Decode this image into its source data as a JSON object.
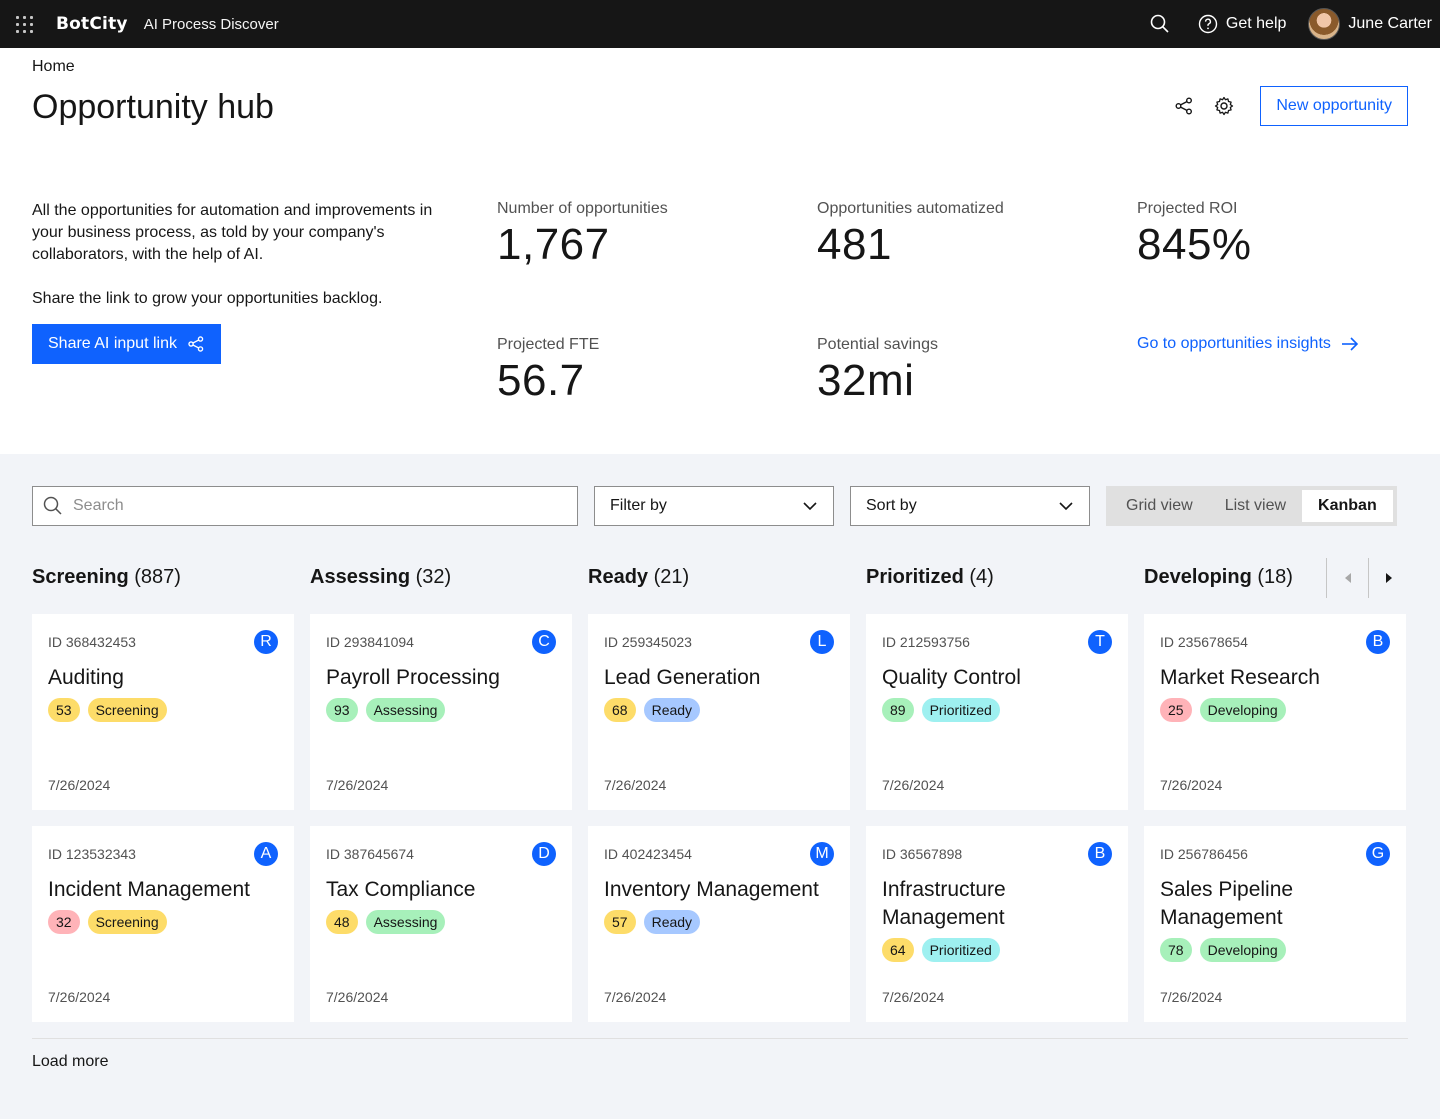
{
  "topbar": {
    "brand": "BotCity",
    "app_name": "AI Process Discover",
    "help_label": "Get help",
    "user_name": "June Carter"
  },
  "header": {
    "breadcrumb": "Home",
    "title": "Opportunity hub",
    "new_button": "New opportunity",
    "intro_line1": "All the opportunities for automation and improvements in your business process, as told by your company's collaborators, with the help of AI.",
    "intro_line2": "Share the link to grow your opportunities backlog.",
    "share_button": "Share AI input link",
    "insights_link": "Go to opportunities insights"
  },
  "metrics": [
    {
      "label": "Number of opportunities",
      "value": "1,767"
    },
    {
      "label": "Opportunities automatized",
      "value": "481"
    },
    {
      "label": "Projected ROI",
      "value": "845%"
    },
    {
      "label": "Projected FTE",
      "value": "56.7"
    },
    {
      "label": "Potential savings",
      "value": "32mi"
    }
  ],
  "toolbar": {
    "search_placeholder": "Search",
    "filter_label": "Filter by",
    "sort_label": "Sort by",
    "views": [
      "Grid view",
      "List view",
      "Kanban"
    ],
    "active_view": "Kanban"
  },
  "columns": [
    {
      "name": "Screening",
      "count": "(887)"
    },
    {
      "name": "Assessing",
      "count": "(32)"
    },
    {
      "name": "Ready",
      "count": "(21)"
    },
    {
      "name": "Prioritized",
      "count": "(4)"
    },
    {
      "name": "Developing",
      "count": "(18)"
    }
  ],
  "colors": {
    "accent": "#0f62fe",
    "status_screening": "#fddc69",
    "status_assessing": "#a7f0ba",
    "status_ready": "#a6c8ff",
    "status_prioritized": "#9ef0f0",
    "status_developing": "#a7f0ba",
    "score_yellow": "#fddc69",
    "score_green": "#a7f0ba",
    "score_red": "#ffb3b8"
  },
  "cards": [
    [
      {
        "id": "ID 368432453",
        "initial": "R",
        "title": "Auditing",
        "score": "53",
        "score_color": "#fddc69",
        "status": "Screening",
        "status_color": "#fddc69",
        "date": "7/26/2024"
      },
      {
        "id": "ID 123532343",
        "initial": "A",
        "title": "Incident Management",
        "score": "32",
        "score_color": "#ffb3b8",
        "status": "Screening",
        "status_color": "#fddc69",
        "date": "7/26/2024"
      }
    ],
    [
      {
        "id": "ID 293841094",
        "initial": "C",
        "title": "Payroll Processing",
        "score": "93",
        "score_color": "#a7f0ba",
        "status": "Assessing",
        "status_color": "#a7f0ba",
        "date": "7/26/2024"
      },
      {
        "id": "ID 387645674",
        "initial": "D",
        "title": "Tax Compliance",
        "score": "48",
        "score_color": "#fddc69",
        "status": "Assessing",
        "status_color": "#a7f0ba",
        "date": "7/26/2024"
      }
    ],
    [
      {
        "id": "ID 259345023",
        "initial": "L",
        "title": "Lead Generation",
        "score": "68",
        "score_color": "#fddc69",
        "status": "Ready",
        "status_color": "#a6c8ff",
        "date": "7/26/2024"
      },
      {
        "id": "ID 402423454",
        "initial": "M",
        "title": "Inventory Management",
        "score": "57",
        "score_color": "#fddc69",
        "status": "Ready",
        "status_color": "#a6c8ff",
        "date": "7/26/2024"
      }
    ],
    [
      {
        "id": "ID 212593756",
        "initial": "T",
        "title": "Quality Control",
        "score": "89",
        "score_color": "#a7f0ba",
        "status": "Prioritized",
        "status_color": "#9ef0f0",
        "date": "7/26/2024"
      },
      {
        "id": "ID 36567898",
        "initial": "B",
        "title": "Infrastructure Management",
        "score": "64",
        "score_color": "#fddc69",
        "status": "Prioritized",
        "status_color": "#9ef0f0",
        "date": "7/26/2024"
      }
    ],
    [
      {
        "id": "ID 235678654",
        "initial": "B",
        "title": "Market Research",
        "score": "25",
        "score_color": "#ffb3b8",
        "status": "Developing",
        "status_color": "#a7f0ba",
        "date": "7/26/2024"
      },
      {
        "id": "ID 256786456",
        "initial": "G",
        "title": "Sales Pipeline Management",
        "score": "78",
        "score_color": "#a7f0ba",
        "status": "Developing",
        "status_color": "#a7f0ba",
        "date": "7/26/2024"
      }
    ]
  ],
  "load_more": "Load more"
}
